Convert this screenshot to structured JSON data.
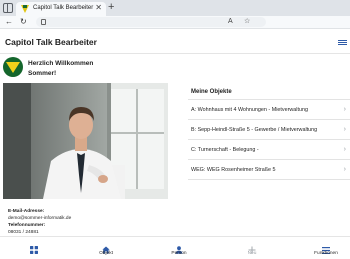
{
  "browser": {
    "tab_title": "Capitol Talk Bearbeiter",
    "tab_close": "✕",
    "new_tab": "+",
    "back": "←",
    "reload": "↻",
    "read_aloud": "A",
    "favorite": "☆"
  },
  "header": {
    "title": "Capitol Talk Bearbeiter"
  },
  "welcome": {
    "line1": "Herzlich Willkommen",
    "line2": "Sommer!"
  },
  "contact": {
    "email_label": "E-Mail-Adresse:",
    "email_value": "demo@sommer-informatik.de",
    "phone_label": "Telefonnummer:",
    "phone_value": "08031 / 24881"
  },
  "objects": {
    "heading": "Meine Objekte",
    "items": [
      {
        "label": "A: Wohnhaus mit 4 Wohnungen - Mietverwaltung"
      },
      {
        "label": "B: Sepp-Heindl-Straße 5 - Gewerbe / Mietverwaltung"
      },
      {
        "label": "C: Turnerschaft - Belegung -"
      },
      {
        "label": "WEG: WEG Rosenheimer Straße 5"
      }
    ],
    "chevron": "›"
  },
  "bottom_nav": {
    "items": [
      {
        "label": "",
        "icon": "grid-icon"
      },
      {
        "label": "Objekt",
        "icon": "home-icon"
      },
      {
        "label": "Person",
        "icon": "person-icon"
      },
      {
        "label": "Neu",
        "icon": "plus-icon"
      },
      {
        "label": "Funktionen",
        "icon": "menu-icon"
      }
    ]
  },
  "colors": {
    "accent": "#2e5aa8",
    "logo_green": "#14662c",
    "logo_yellow": "#f0d21b"
  }
}
